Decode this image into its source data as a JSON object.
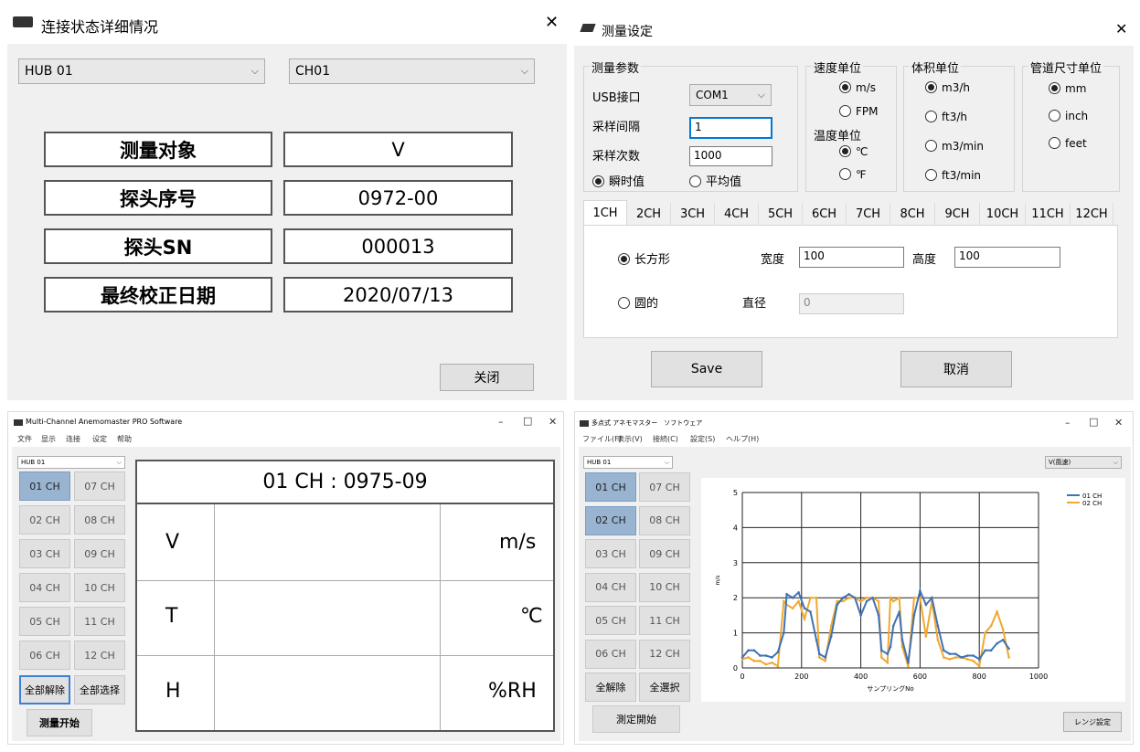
{
  "conn_dialog": {
    "title": "连接状态详细情况",
    "hub": "HUB 01",
    "channel": "CH01",
    "rows": [
      {
        "label": "测量对象",
        "value": "V"
      },
      {
        "label": "探头序号",
        "value": "0972-00"
      },
      {
        "label": "探头SN",
        "value": "000013"
      },
      {
        "label": "最终校正日期",
        "value": "2020/07/13"
      }
    ],
    "close_label": "关闭"
  },
  "settings_dialog": {
    "title": "测量设定",
    "params": {
      "title": "测量参数",
      "usb_label": "USB接口",
      "usb_value": "COM1",
      "interval_label": "采样间隔",
      "interval_value": "1",
      "count_label": "采样次数",
      "count_value": "1000",
      "instant": "瞬时值",
      "average": "平均值"
    },
    "speed": {
      "title": "速度单位",
      "options": [
        "m/s",
        "FPM"
      ]
    },
    "temp": {
      "title": "温度单位",
      "options": [
        "℃",
        "℉"
      ]
    },
    "volume": {
      "title": "体积单位",
      "options": [
        "m3/h",
        "ft3/h",
        "m3/min",
        "ft3/min"
      ]
    },
    "pipe": {
      "title": "管道尺寸单位",
      "options": [
        "mm",
        "inch",
        "feet"
      ]
    },
    "tabs": [
      "1CH",
      "2CH",
      "3CH",
      "4CH",
      "5CH",
      "6CH",
      "7CH",
      "8CH",
      "9CH",
      "10CH",
      "11CH",
      "12CH"
    ],
    "rect_label": "长方形",
    "width_label": "宽度",
    "width_value": "100",
    "height_label": "高度",
    "height_value": "100",
    "round_label": "圆的",
    "diameter_label": "直径",
    "diameter_value": "0",
    "save_label": "Save",
    "cancel_label": "取消"
  },
  "cn_app": {
    "title": "Multi-Channel Anemomaster PRO Software",
    "menus": [
      "文件",
      "显示",
      "连接",
      "设定",
      "帮助"
    ],
    "hub": "HUB 01",
    "channels": [
      "01 CH",
      "07 CH",
      "02 CH",
      "08 CH",
      "03 CH",
      "09 CH",
      "04 CH",
      "10 CH",
      "05 CH",
      "11 CH",
      "06 CH",
      "12 CH"
    ],
    "clear_all": "全部解除",
    "select_all": "全部选择",
    "start": "测量开始",
    "display_header": "01 CH : 0975-09",
    "rows": [
      {
        "param": "V",
        "unit": "m/s"
      },
      {
        "param": "T",
        "unit": "℃"
      },
      {
        "param": "H",
        "unit": "%RH"
      }
    ]
  },
  "jp_app": {
    "title": "多点式 アネモマスター　ソフトウェア",
    "menus": [
      "ファイル(F)",
      "表示(V)",
      "接続(C)",
      "設定(S)",
      "ヘルプ(H)"
    ],
    "hub": "HUB 01",
    "channels": [
      "01 CH",
      "07 CH",
      "02 CH",
      "08 CH",
      "03 CH",
      "09 CH",
      "04 CH",
      "10 CH",
      "05 CH",
      "11 CH",
      "06 CH",
      "12 CH"
    ],
    "clear_all": "全解除",
    "select_all": "全選択",
    "start": "測定開始",
    "measure_select": "V(風速)",
    "range_button": "レンジ設定"
  },
  "window_controls": {
    "minimize": "–",
    "maximize": "□",
    "close": "✕"
  },
  "chart_data": {
    "type": "line",
    "xlabel": "サンプリングNo",
    "ylabel": "m/s",
    "xlim": [
      0,
      1000
    ],
    "ylim": [
      0,
      5
    ],
    "xticks": [
      "0",
      "200",
      "400",
      "600",
      "800",
      "1000"
    ],
    "yticks": [
      "0",
      "1",
      "2",
      "3",
      "4",
      "5"
    ],
    "grid": true,
    "legend": "top-right",
    "x": [
      0,
      20,
      40,
      60,
      80,
      100,
      120,
      140,
      150,
      170,
      190,
      210,
      230,
      250,
      260,
      280,
      300,
      320,
      340,
      360,
      380,
      400,
      420,
      440,
      460,
      470,
      490,
      500,
      510,
      530,
      540,
      560,
      580,
      600,
      620,
      640,
      660,
      680,
      700,
      720,
      740,
      760,
      780,
      800,
      820,
      840,
      860,
      880,
      900
    ],
    "series": [
      {
        "name": "01 CH",
        "color": "#3f72b5",
        "values": [
          0.3,
          0.5,
          0.5,
          0.35,
          0.35,
          0.3,
          0.45,
          1.0,
          2.1,
          2.0,
          2.15,
          1.7,
          1.6,
          0.8,
          0.4,
          0.3,
          0.9,
          1.8,
          2.0,
          2.1,
          2.0,
          1.5,
          1.9,
          2.0,
          1.5,
          0.5,
          0.4,
          0.6,
          1.2,
          1.6,
          0.8,
          0.15,
          1.5,
          2.2,
          1.8,
          2.0,
          1.2,
          0.5,
          0.4,
          0.4,
          0.3,
          0.35,
          0.35,
          0.25,
          0.5,
          0.5,
          0.7,
          0.8,
          0.55
        ]
      },
      {
        "name": "02 CH",
        "color": "#f0a830",
        "values": [
          0.25,
          0.3,
          0.2,
          0.2,
          0.1,
          0.15,
          0.05,
          1.9,
          1.8,
          1.7,
          1.9,
          1.4,
          2.0,
          2.0,
          0.3,
          0.2,
          1.2,
          1.9,
          1.9,
          2.0,
          2.0,
          1.9,
          2.0,
          2.0,
          1.9,
          0.3,
          0.15,
          2.0,
          1.9,
          2.0,
          0.6,
          0.05,
          2.0,
          2.0,
          0.9,
          1.9,
          0.8,
          0.3,
          0.25,
          0.3,
          0.3,
          0.25,
          0.2,
          0.05,
          1.0,
          1.2,
          1.6,
          1.1,
          0.3
        ]
      }
    ]
  }
}
